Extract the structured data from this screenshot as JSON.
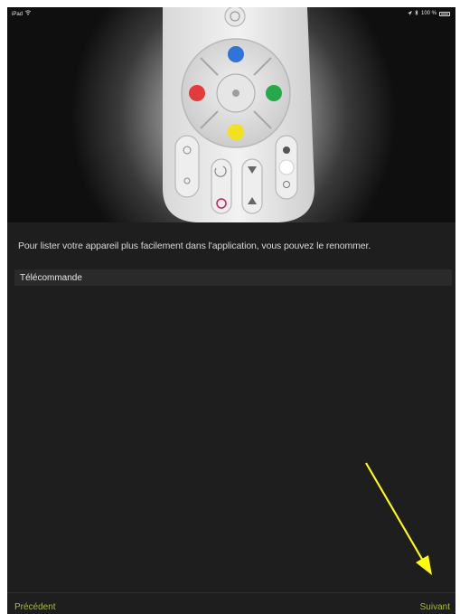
{
  "status_bar": {
    "device": "iPad",
    "wifi_icon": "wifi-icon",
    "battery_text": "100 %",
    "icons": [
      "location-arrow-icon",
      "bluetooth-icon",
      "battery-icon"
    ]
  },
  "hero": {
    "image": "remote-control-image",
    "button_colors": {
      "top": "#2f74d6",
      "left": "#e33b3b",
      "right": "#27a84a",
      "bottom": "#f2e21b"
    }
  },
  "form": {
    "instruction": "Pour lister votre appareil plus facilement dans l'application, vous pouvez le renommer.",
    "device_name_value": "Télécommande"
  },
  "nav": {
    "previous_label": "Précédent",
    "next_label": "Suivant",
    "accent_color": "#9fbf2a"
  },
  "annotation": {
    "arrow_color": "#ffff00",
    "arrow_icon": "arrow-down-right-icon"
  }
}
